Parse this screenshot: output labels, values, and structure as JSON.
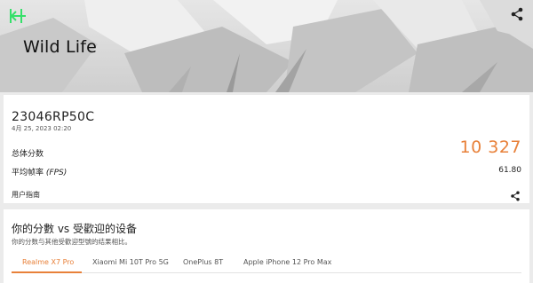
{
  "header": {
    "title": "Wild Life"
  },
  "result": {
    "device": "23046RP50C",
    "date": "4月 25, 2023 02:20",
    "score_label": "总体分数",
    "score_value": "10 327",
    "fps_label": "平均帧率",
    "fps_unit": "(FPS)",
    "fps_value": "61.80",
    "guide_label": "用户指南"
  },
  "comparison": {
    "title": "你的分數 vs 受歡迎的设备",
    "subtitle": "你的分数与其他受歡迎型號的结果相比。",
    "tabs": [
      {
        "label": "Realme X7 Pro",
        "active": true
      },
      {
        "label": "Xiaomi Mi 10T Pro 5G",
        "active": false
      },
      {
        "label": "OnePlus 8T",
        "active": false
      },
      {
        "label": "Apple iPhone 12 Pro Max",
        "active": false
      }
    ]
  },
  "colors": {
    "accent": "#e8813a",
    "back_icon": "#35e06a"
  },
  "icons": {
    "back": "back-arrow-icon",
    "share": "share-icon"
  }
}
